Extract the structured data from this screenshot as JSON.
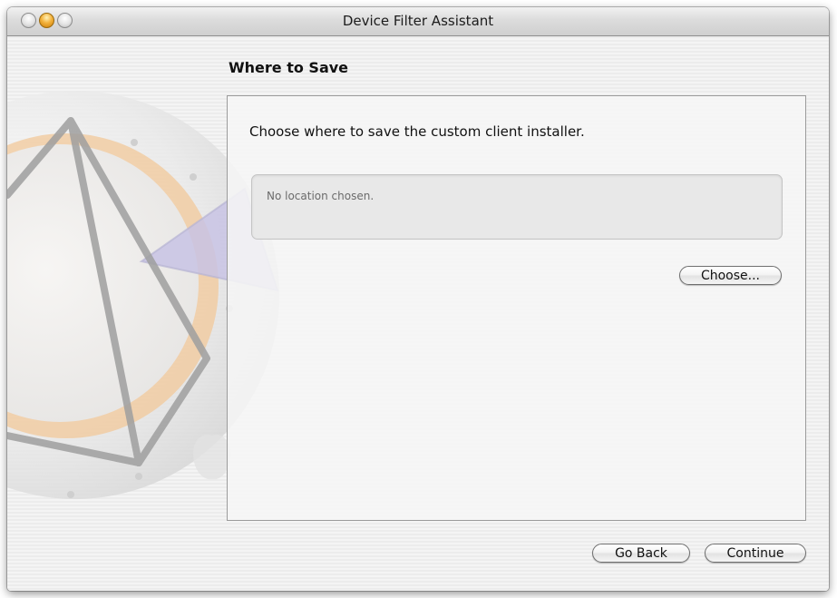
{
  "window": {
    "title": "Device Filter Assistant"
  },
  "page": {
    "heading": "Where to Save",
    "instruction": "Choose where to save the custom client installer.",
    "location_text": "No location chosen."
  },
  "buttons": {
    "choose_label": "Choose...",
    "go_back_label": "Go Back",
    "continue_label": "Continue"
  },
  "icons": {
    "background_art": "directory-utility-compass-icon"
  },
  "colors": {
    "minimize_button": "#f3b23c",
    "art_orange": "#f2c89a",
    "art_lavender": "#c8c3e4"
  }
}
